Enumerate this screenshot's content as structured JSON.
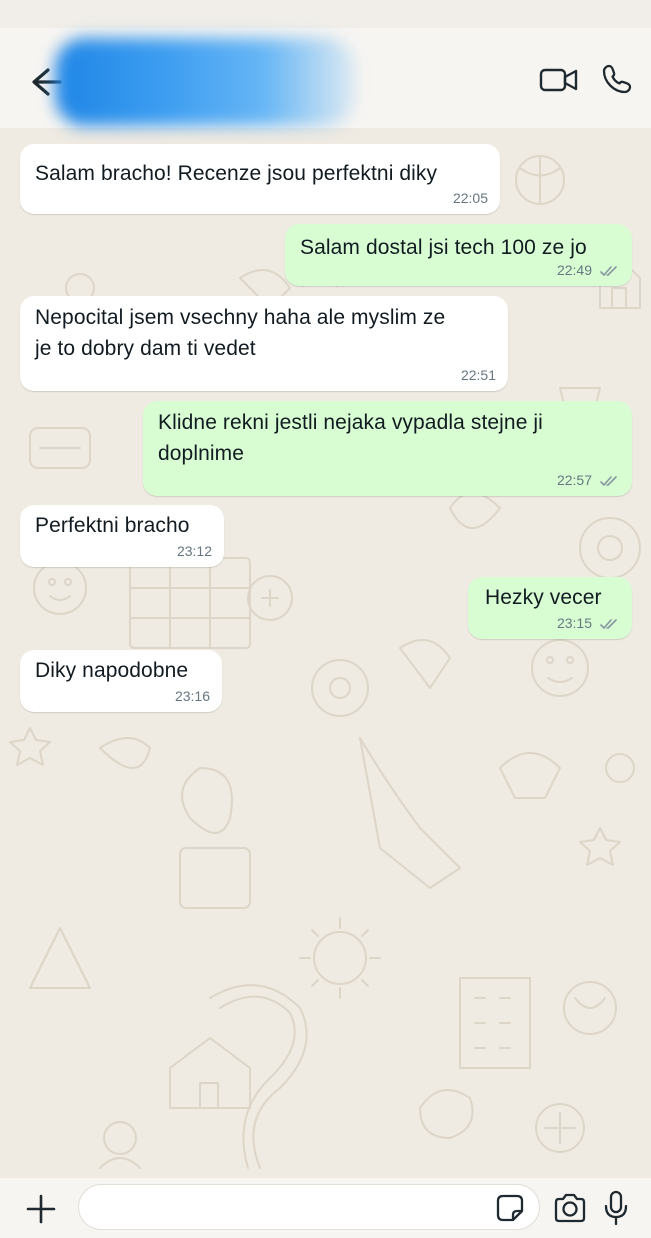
{
  "header": {
    "contact_name": "",
    "icons": {
      "back": "arrow-left-icon",
      "video": "video-call-icon",
      "phone": "voice-call-icon"
    }
  },
  "messages": [
    {
      "direction": "incoming",
      "text": "Salam bracho! Recenze jsou perfektni diky",
      "time": "22:05"
    },
    {
      "direction": "outgoing",
      "text": "Salam dostal jsi tech 100 ze jo",
      "time": "22:49",
      "status": "read"
    },
    {
      "direction": "incoming",
      "text": "Nepocital jsem vsechny haha ale myslim ze\nje to dobry dam ti vedet",
      "time": "22:51"
    },
    {
      "direction": "outgoing",
      "text": "Klidne rekni jestli nejaka vypadla stejne ji\ndoplnime",
      "time": "22:57",
      "status": "read"
    },
    {
      "direction": "incoming",
      "text": "Perfektni bracho",
      "time": "23:12"
    },
    {
      "direction": "outgoing",
      "text": "Hezky vecer",
      "time": "23:15",
      "status": "read"
    },
    {
      "direction": "incoming",
      "text": "Diky napodobne",
      "time": "23:16"
    }
  ],
  "composer": {
    "value": "",
    "placeholder": "",
    "icons": {
      "attach": "plus-icon",
      "sticker": "sticker-icon",
      "camera": "camera-icon",
      "mic": "microphone-icon"
    }
  },
  "colors": {
    "incoming_bubble": "#ffffff",
    "outgoing_bubble": "#d9fdd3",
    "wallpaper": "#efeae2",
    "tick": "#8696a0"
  }
}
